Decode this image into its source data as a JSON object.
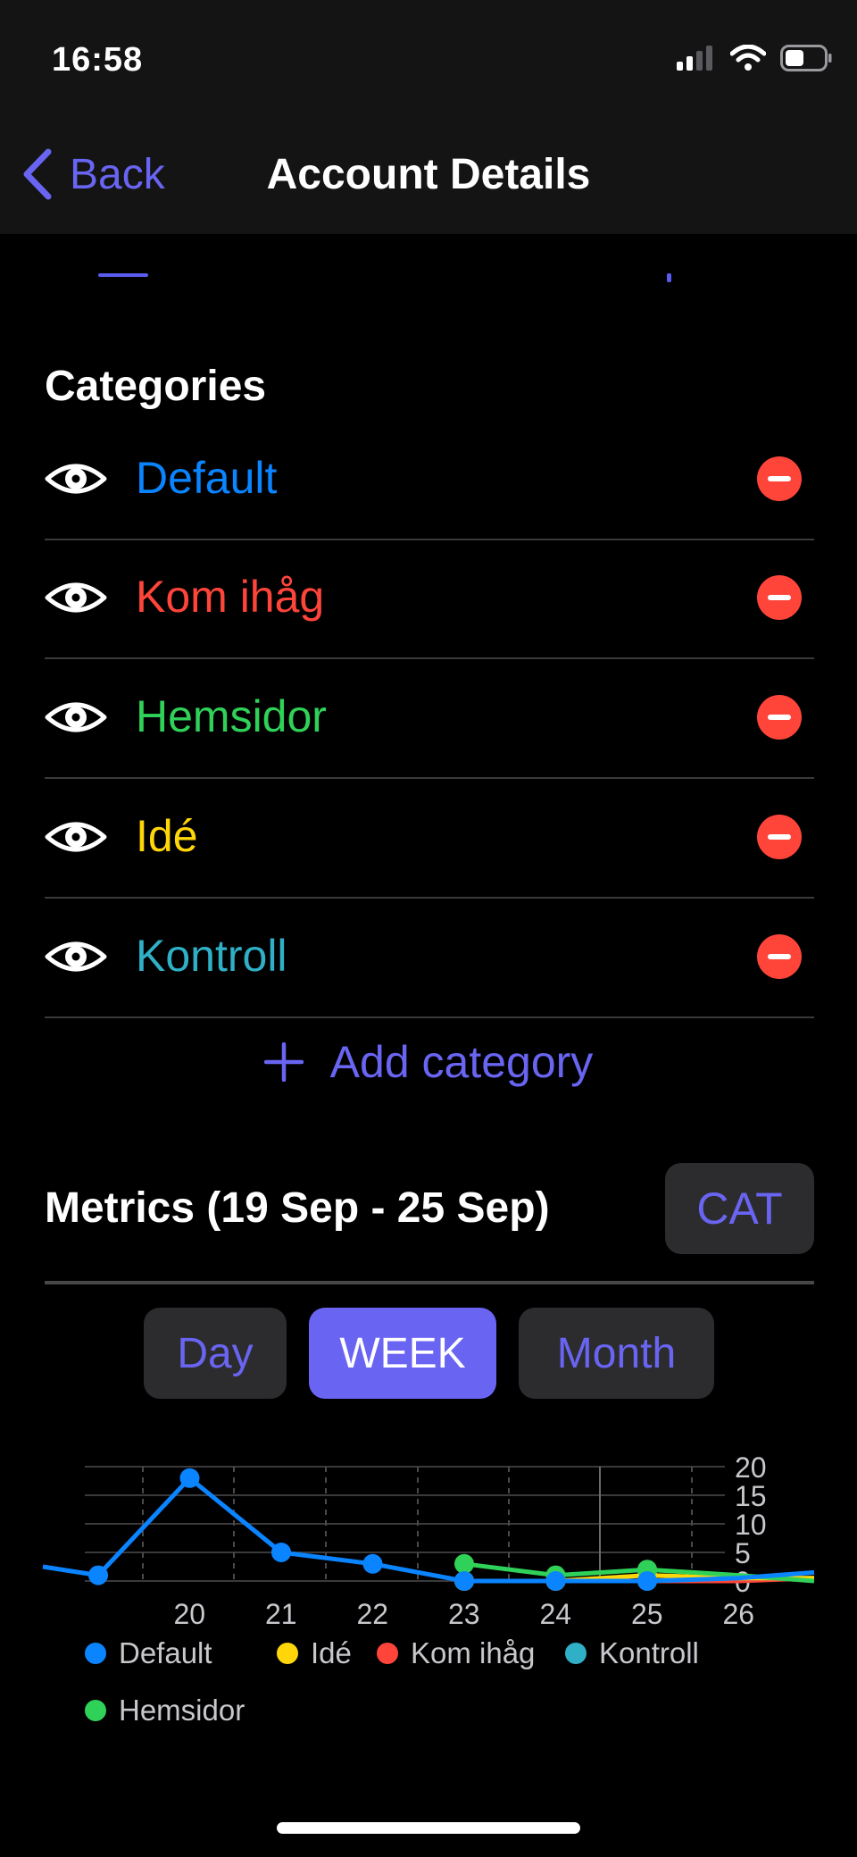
{
  "status": {
    "time": "16:58"
  },
  "nav": {
    "back_label": "Back",
    "title": "Account Details"
  },
  "categories": {
    "title": "Categories",
    "items": [
      {
        "name": "Default",
        "color": "#0a84ff"
      },
      {
        "name": "Kom ihåg",
        "color": "#ff453a"
      },
      {
        "name": "Hemsidor",
        "color": "#30d158"
      },
      {
        "name": "Idé",
        "color": "#ffd60a"
      },
      {
        "name": "Kontroll",
        "color": "#30b0c7"
      }
    ],
    "add_label": "Add category"
  },
  "metrics": {
    "title": "Metrics (19 Sep -  25 Sep)",
    "cat_button": "CAT",
    "segments": [
      {
        "label": "Day",
        "active": false
      },
      {
        "label": "WEEK",
        "active": true
      },
      {
        "label": "Month",
        "active": false
      }
    ]
  },
  "chart_data": {
    "type": "line",
    "x": [
      19,
      20,
      21,
      22,
      23,
      24,
      25,
      26
    ],
    "x_tick_labels": [
      "20",
      "21",
      "22",
      "23",
      "24",
      "25",
      "26"
    ],
    "y_tick_labels": [
      "20",
      "15",
      "10",
      "5",
      "0"
    ],
    "ylim": [
      0,
      20
    ],
    "series": [
      {
        "name": "Default",
        "color": "#0a84ff",
        "values": [
          1,
          18,
          5,
          3,
          0,
          0,
          0,
          0.5
        ]
      },
      {
        "name": "Idé",
        "color": "#ffd60a",
        "values": [
          null,
          null,
          null,
          null,
          0,
          0,
          1,
          0.5
        ]
      },
      {
        "name": "Kom ihåg",
        "color": "#ff453a",
        "values": [
          null,
          null,
          null,
          null,
          0,
          0,
          0,
          0
        ]
      },
      {
        "name": "Kontroll",
        "color": "#30b0c7",
        "values": [
          null,
          null,
          null,
          null,
          0,
          0,
          0,
          0.5
        ]
      },
      {
        "name": "Hemsidor",
        "color": "#30d158",
        "values": [
          null,
          null,
          null,
          null,
          3,
          1,
          2,
          1
        ]
      }
    ]
  }
}
